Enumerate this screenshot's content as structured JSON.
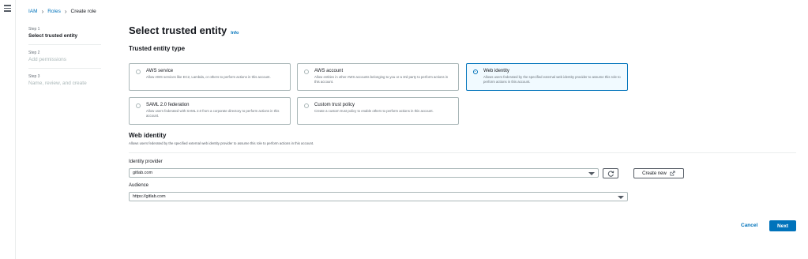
{
  "breadcrumb": {
    "items": [
      "IAM",
      "Roles",
      "Create role"
    ],
    "separator": "›"
  },
  "steps": [
    {
      "num": "Step 1",
      "title": "Select trusted entity"
    },
    {
      "num": "Step 2",
      "title": "Add permissions"
    },
    {
      "num": "Step 3",
      "title": "Name, review, and create"
    }
  ],
  "page": {
    "title": "Select trusted entity",
    "info": "Info"
  },
  "trusted_entity": {
    "section_title": "Trusted entity type",
    "options": [
      {
        "title": "AWS service",
        "desc": "Allow AWS services like EC2, Lambda, or others to perform actions in this account.",
        "selected": false
      },
      {
        "title": "AWS account",
        "desc": "Allow entities in other AWS accounts belonging to you or a 3rd party to perform actions in this account.",
        "selected": false
      },
      {
        "title": "Web identity",
        "desc": "Allows users federated by the specified external web identity provider to assume this role to perform actions in this account.",
        "selected": true
      },
      {
        "title": "SAML 2.0 federation",
        "desc": "Allow users federated with SAML 2.0 from a corporate directory to perform actions in this account.",
        "selected": false
      },
      {
        "title": "Custom trust policy",
        "desc": "Create a custom trust policy to enable others to perform actions in this account.",
        "selected": false
      }
    ]
  },
  "web_identity": {
    "title": "Web identity",
    "desc": "Allows users federated by the specified external web identity provider to assume this role to perform actions in this account.",
    "identity_provider_label": "Identity provider",
    "identity_provider_value": "gitlab.com",
    "create_new": "Create new",
    "audience_label": "Audience",
    "audience_value": "https://gitlab.com"
  },
  "footer": {
    "cancel": "Cancel",
    "next": "Next"
  },
  "colors": {
    "accent": "#0073bb",
    "selected_bg": "#f1faff",
    "border": "#aab7b8"
  },
  "icons": [
    "menu-icon",
    "refresh-icon",
    "external-link-icon",
    "caret-down-icon"
  ]
}
